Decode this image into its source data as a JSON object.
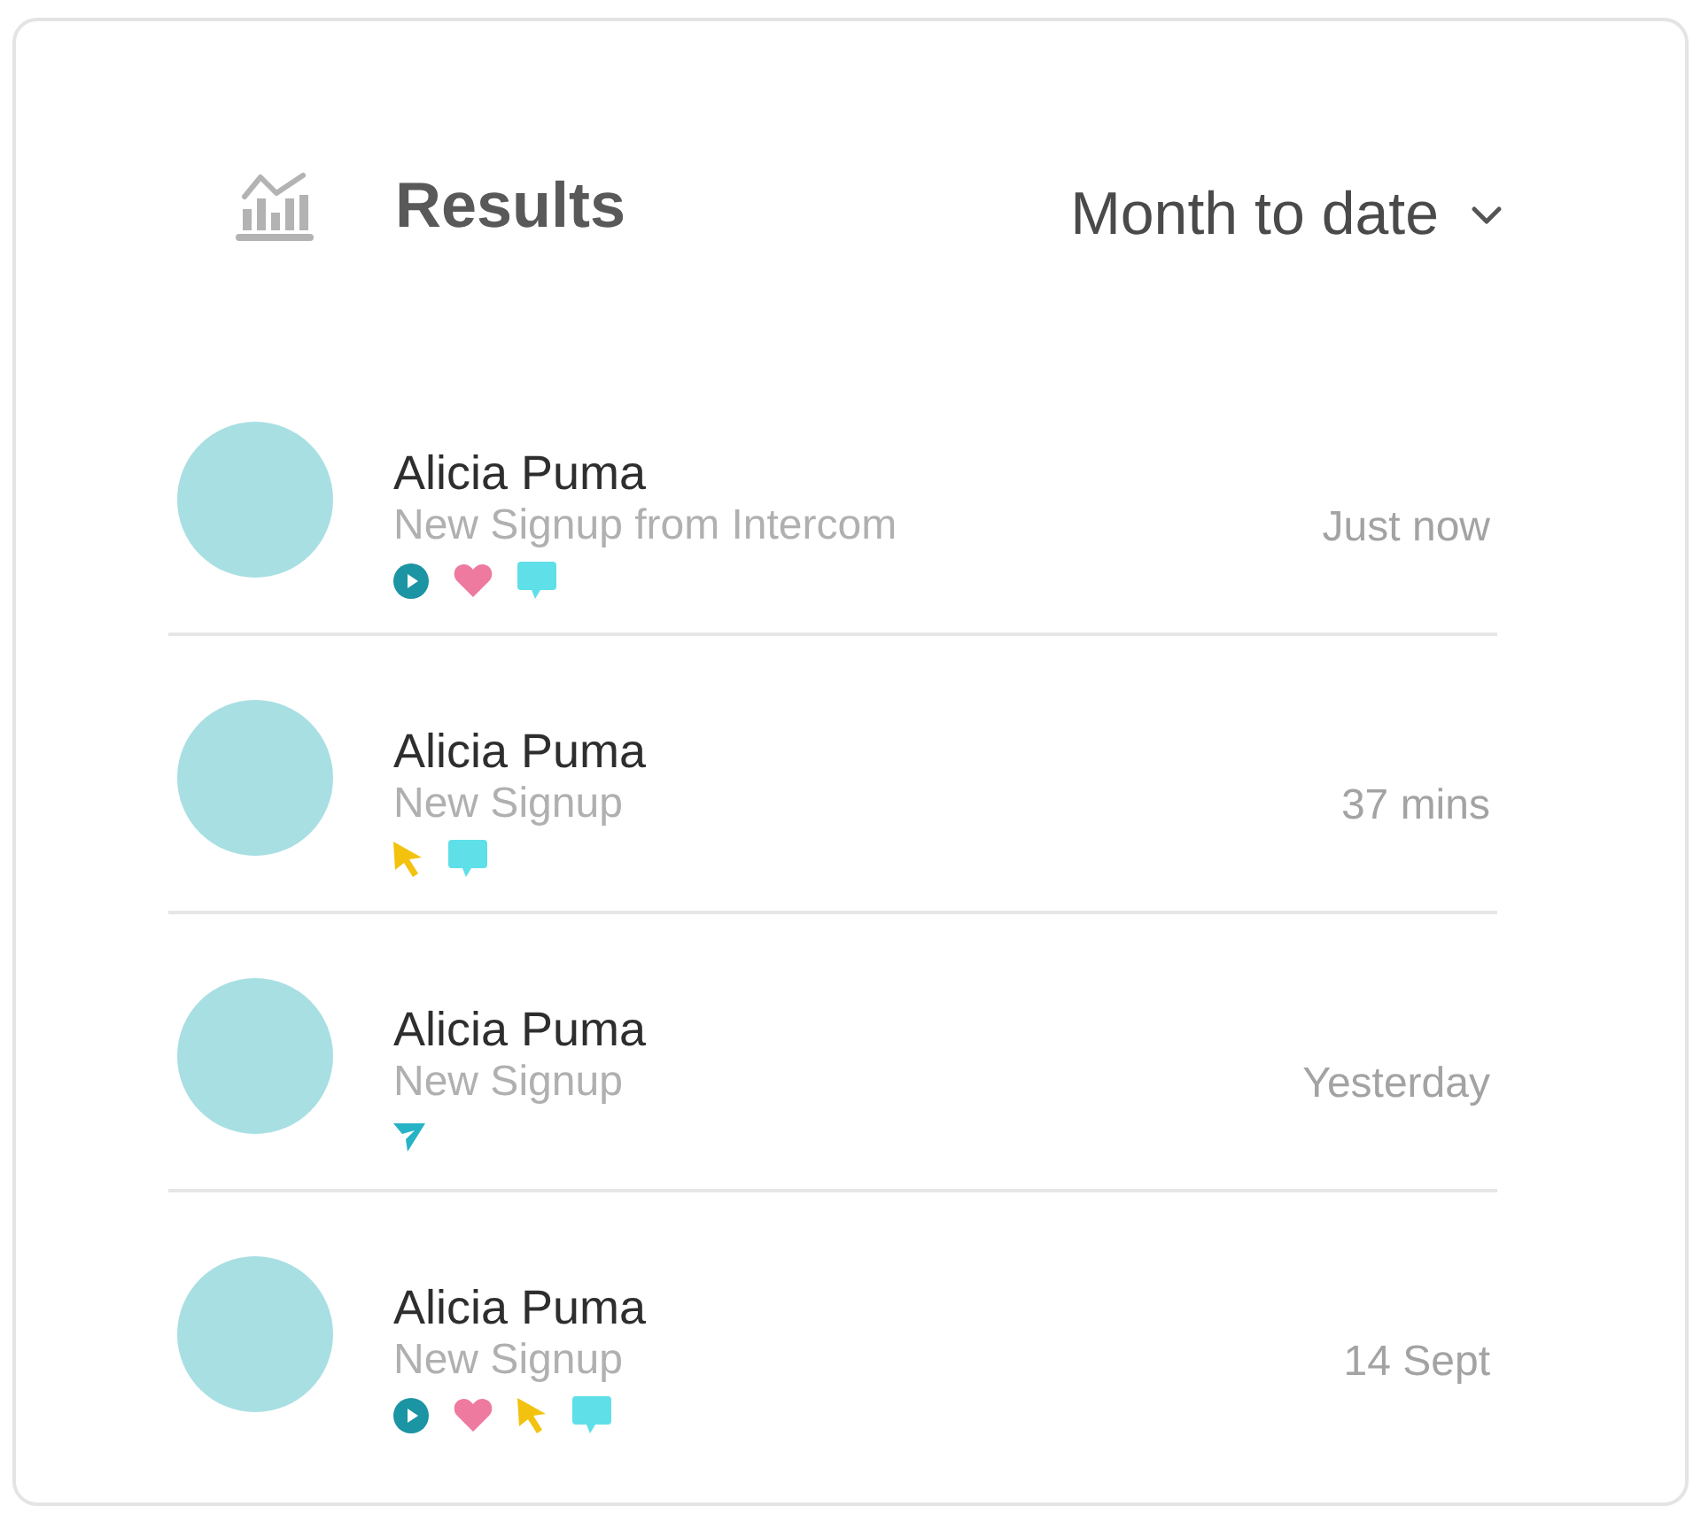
{
  "header": {
    "title": "Results",
    "range": "Month to date"
  },
  "activities": [
    {
      "name": "Alicia Puma",
      "description": "New Signup from Intercom",
      "time": "Just now",
      "badges": [
        {
          "kind": "play"
        },
        {
          "kind": "heart"
        },
        {
          "kind": "chat"
        }
      ]
    },
    {
      "name": "Alicia Puma",
      "description": "New Signup",
      "time": "37 mins",
      "badges": [
        {
          "kind": "cursor"
        },
        {
          "kind": "chat"
        }
      ]
    },
    {
      "name": "Alicia Puma",
      "description": "New Signup",
      "time": "Yesterday",
      "badges": [
        {
          "kind": "send"
        }
      ]
    },
    {
      "name": "Alicia Puma",
      "description": "New Signup",
      "time": "14 Sept",
      "badges": [
        {
          "kind": "play"
        },
        {
          "kind": "heart"
        },
        {
          "kind": "cursor"
        },
        {
          "kind": "chat"
        }
      ]
    }
  ]
}
